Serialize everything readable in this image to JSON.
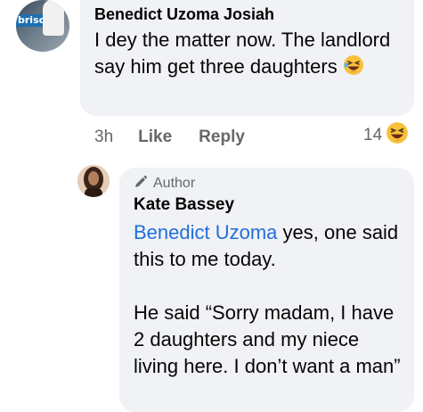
{
  "comment": {
    "author": "Benedict Uzoma Josiah",
    "avatar_banner_text": "brisc",
    "text": "I dey the matter now. The landlord say him get three daughters",
    "text_emoji": "laughing-face-icon",
    "time": "3h",
    "like_label": "Like",
    "reply_label": "Reply",
    "reaction_count": "14",
    "reaction_emoji": "laughing-face-icon"
  },
  "reply": {
    "author_badge": "Author",
    "author_badge_icon": "pencil-icon",
    "author": "Kate Bassey",
    "mention": "Benedict Uzoma",
    "text_part1": " yes, one said this to me today.",
    "text_part2": "He said “Sorry madam, I have 2 daughters and my niece living here. I don’t want a man”"
  },
  "colors": {
    "bubble": "#f0f2f5",
    "secondary_text": "#65676b",
    "mention": "#216fdb",
    "emoji_yellow": "#f7c13a"
  }
}
